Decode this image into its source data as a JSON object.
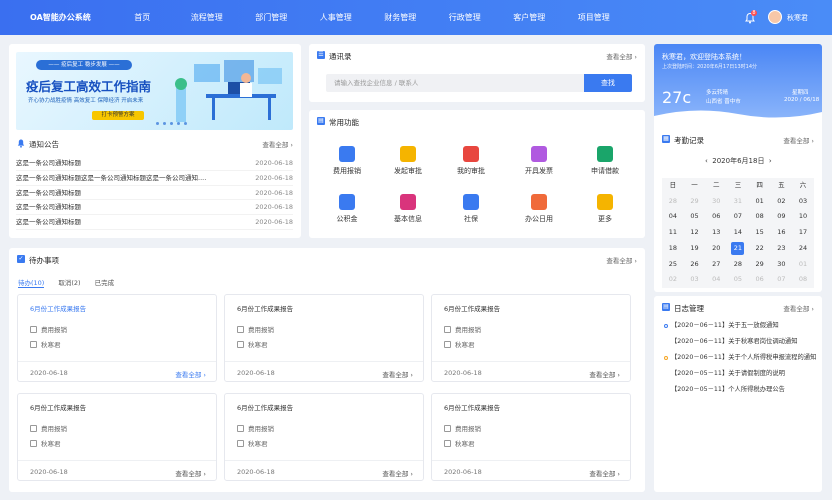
{
  "app": {
    "name": "OA智能办公系统",
    "user": "秋寒君",
    "bell_count": "8"
  },
  "nav": [
    "首页",
    "流程管理",
    "部门管理",
    "人事管理",
    "财务管理",
    "行政管理",
    "客户管理",
    "项目管理"
  ],
  "banner": {
    "chip": "—— 疫后复工 稳步发展 ——",
    "title": "疫后复工高效工作指南",
    "subtitle": "齐心协力战胜疫情 高效复工 保障经济 开启未来",
    "button": "打卡预警方案"
  },
  "notices": {
    "title": "通知公告",
    "more": "查看全部",
    "items": [
      {
        "text": "这是一条公司通知标题",
        "date": "2020-06-18"
      },
      {
        "text": "这是一条公司通知标题这是一条公司通知标题这是一条公司通知......",
        "date": "2020-06-18"
      },
      {
        "text": "这是一条公司通知标题",
        "date": "2020-06-18"
      },
      {
        "text": "这是一条公司通知标题",
        "date": "2020-06-18"
      },
      {
        "text": "这是一条公司通知标题",
        "date": "2020-06-18"
      }
    ]
  },
  "contacts": {
    "title": "通讯录",
    "more": "查看全部",
    "placeholder": "请输入查找企业信息 / 联系人",
    "button": "查找"
  },
  "functions": {
    "title": "常用功能",
    "items": [
      {
        "label": "费用报销",
        "icon": "invoice-icon",
        "color": "#3a7af0"
      },
      {
        "label": "发起审批",
        "icon": "edit-icon",
        "color": "#f5b400"
      },
      {
        "label": "我的审批",
        "icon": "approval-icon",
        "color": "#e8473f"
      },
      {
        "label": "开具发票",
        "icon": "receipt-icon",
        "color": "#b05ae0"
      },
      {
        "label": "申请借款",
        "icon": "money-icon",
        "color": "#1aa56a"
      },
      {
        "label": "公积金",
        "icon": "fund-icon",
        "color": "#3a7af0"
      },
      {
        "label": "基本信息",
        "icon": "info-icon",
        "color": "#d9347c"
      },
      {
        "label": "社保",
        "icon": "insurance-icon",
        "color": "#3a7af0"
      },
      {
        "label": "办公日用",
        "icon": "office-icon",
        "color": "#f06a3a"
      },
      {
        "label": "更多",
        "icon": "grid-icon",
        "color": "#f5b400"
      }
    ]
  },
  "todo": {
    "title": "待办事项",
    "more": "查看全部",
    "tabs": [
      "待办(10)",
      "取消(2)",
      "已完成"
    ],
    "cards": [
      {
        "title": "6月份工作成果报告",
        "type": "费用报销",
        "person": "秋寒君",
        "date": "2020-06-18",
        "more": "查看全部"
      },
      {
        "title": "6月份工作成果报告",
        "type": "费用报销",
        "person": "秋寒君",
        "date": "2020-06-18",
        "more": "查看全部"
      },
      {
        "title": "6月份工作成果报告",
        "type": "费用报销",
        "person": "秋寒君",
        "date": "2020-06-18",
        "more": "查看全部"
      },
      {
        "title": "6月份工作成果报告",
        "type": "费用报销",
        "person": "秋寒君",
        "date": "2020-06-18",
        "more": "查看全部"
      },
      {
        "title": "6月份工作成果报告",
        "type": "费用报销",
        "person": "秋寒君",
        "date": "2020-06-18",
        "more": "查看全部"
      },
      {
        "title": "6月份工作成果报告",
        "type": "费用报销",
        "person": "秋寒君",
        "date": "2020-06-18",
        "more": "查看全部"
      }
    ]
  },
  "welcome": {
    "greeting": "秋寒君，欢迎登陆本系统！",
    "last_login": "上次登陆时间：2020年6月17日13时14分",
    "temp": "27c",
    "weather": "多云转晴",
    "location": "山西省 晋中市",
    "weekday": "星期四",
    "date": "2020 / 06/18"
  },
  "attendance": {
    "title": "考勤记录",
    "more": "查看全部",
    "month": "2020年6月18日",
    "weekdays": [
      "日",
      "一",
      "二",
      "三",
      "四",
      "五",
      "六"
    ],
    "days": [
      "28",
      "29",
      "30",
      "31",
      "01",
      "02",
      "03",
      "04",
      "05",
      "06",
      "07",
      "08",
      "09",
      "10",
      "11",
      "12",
      "13",
      "14",
      "15",
      "16",
      "17",
      "18",
      "19",
      "20",
      "21",
      "22",
      "23",
      "24",
      "25",
      "26",
      "27",
      "28",
      "29",
      "30",
      "01",
      "02",
      "03",
      "04",
      "05",
      "06",
      "07",
      "08"
    ],
    "today_index": 24
  },
  "log": {
    "title": "日志管理",
    "more": "查看全部",
    "items": [
      {
        "text": "【2020－06－11】关于五一放假通知",
        "dot": "blue"
      },
      {
        "text": "【2020－06－11】关于秋寒君岗位调动通知",
        "dot": "none"
      },
      {
        "text": "【2020－06－11】关于个人所得税申报流程的通知",
        "dot": "yellow"
      },
      {
        "text": "【2020－05－11】关于请假制度的说明",
        "dot": "none"
      },
      {
        "text": "【2020－05－11】个人所得税办理公告",
        "dot": "none"
      }
    ]
  }
}
